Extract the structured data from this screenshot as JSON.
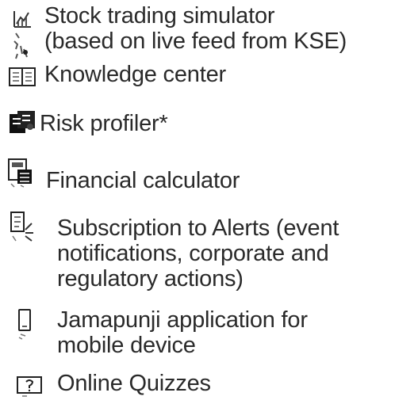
{
  "items": [
    {
      "icon": "chart-icon",
      "lines": [
        "Stock trading simulator",
        "(based on live feed from KSE)"
      ]
    },
    {
      "icon": "book-icon",
      "lines": [
        "Knowledge center"
      ]
    },
    {
      "icon": "puzzle-icon",
      "lines": [
        "Risk profiler*"
      ]
    },
    {
      "icon": "calculator-icon",
      "lines": [
        "Financial calculator"
      ]
    },
    {
      "icon": "alert-icon",
      "lines": [
        "Subscription to Alerts (event",
        "notifications, corporate and",
        "regulatory actions)"
      ]
    },
    {
      "icon": "mobile-device-icon",
      "lines": [
        "Jamapunji application for",
        "mobile device"
      ]
    },
    {
      "icon": "quiz-icon",
      "lines": [
        "Online Quizzes"
      ]
    }
  ]
}
